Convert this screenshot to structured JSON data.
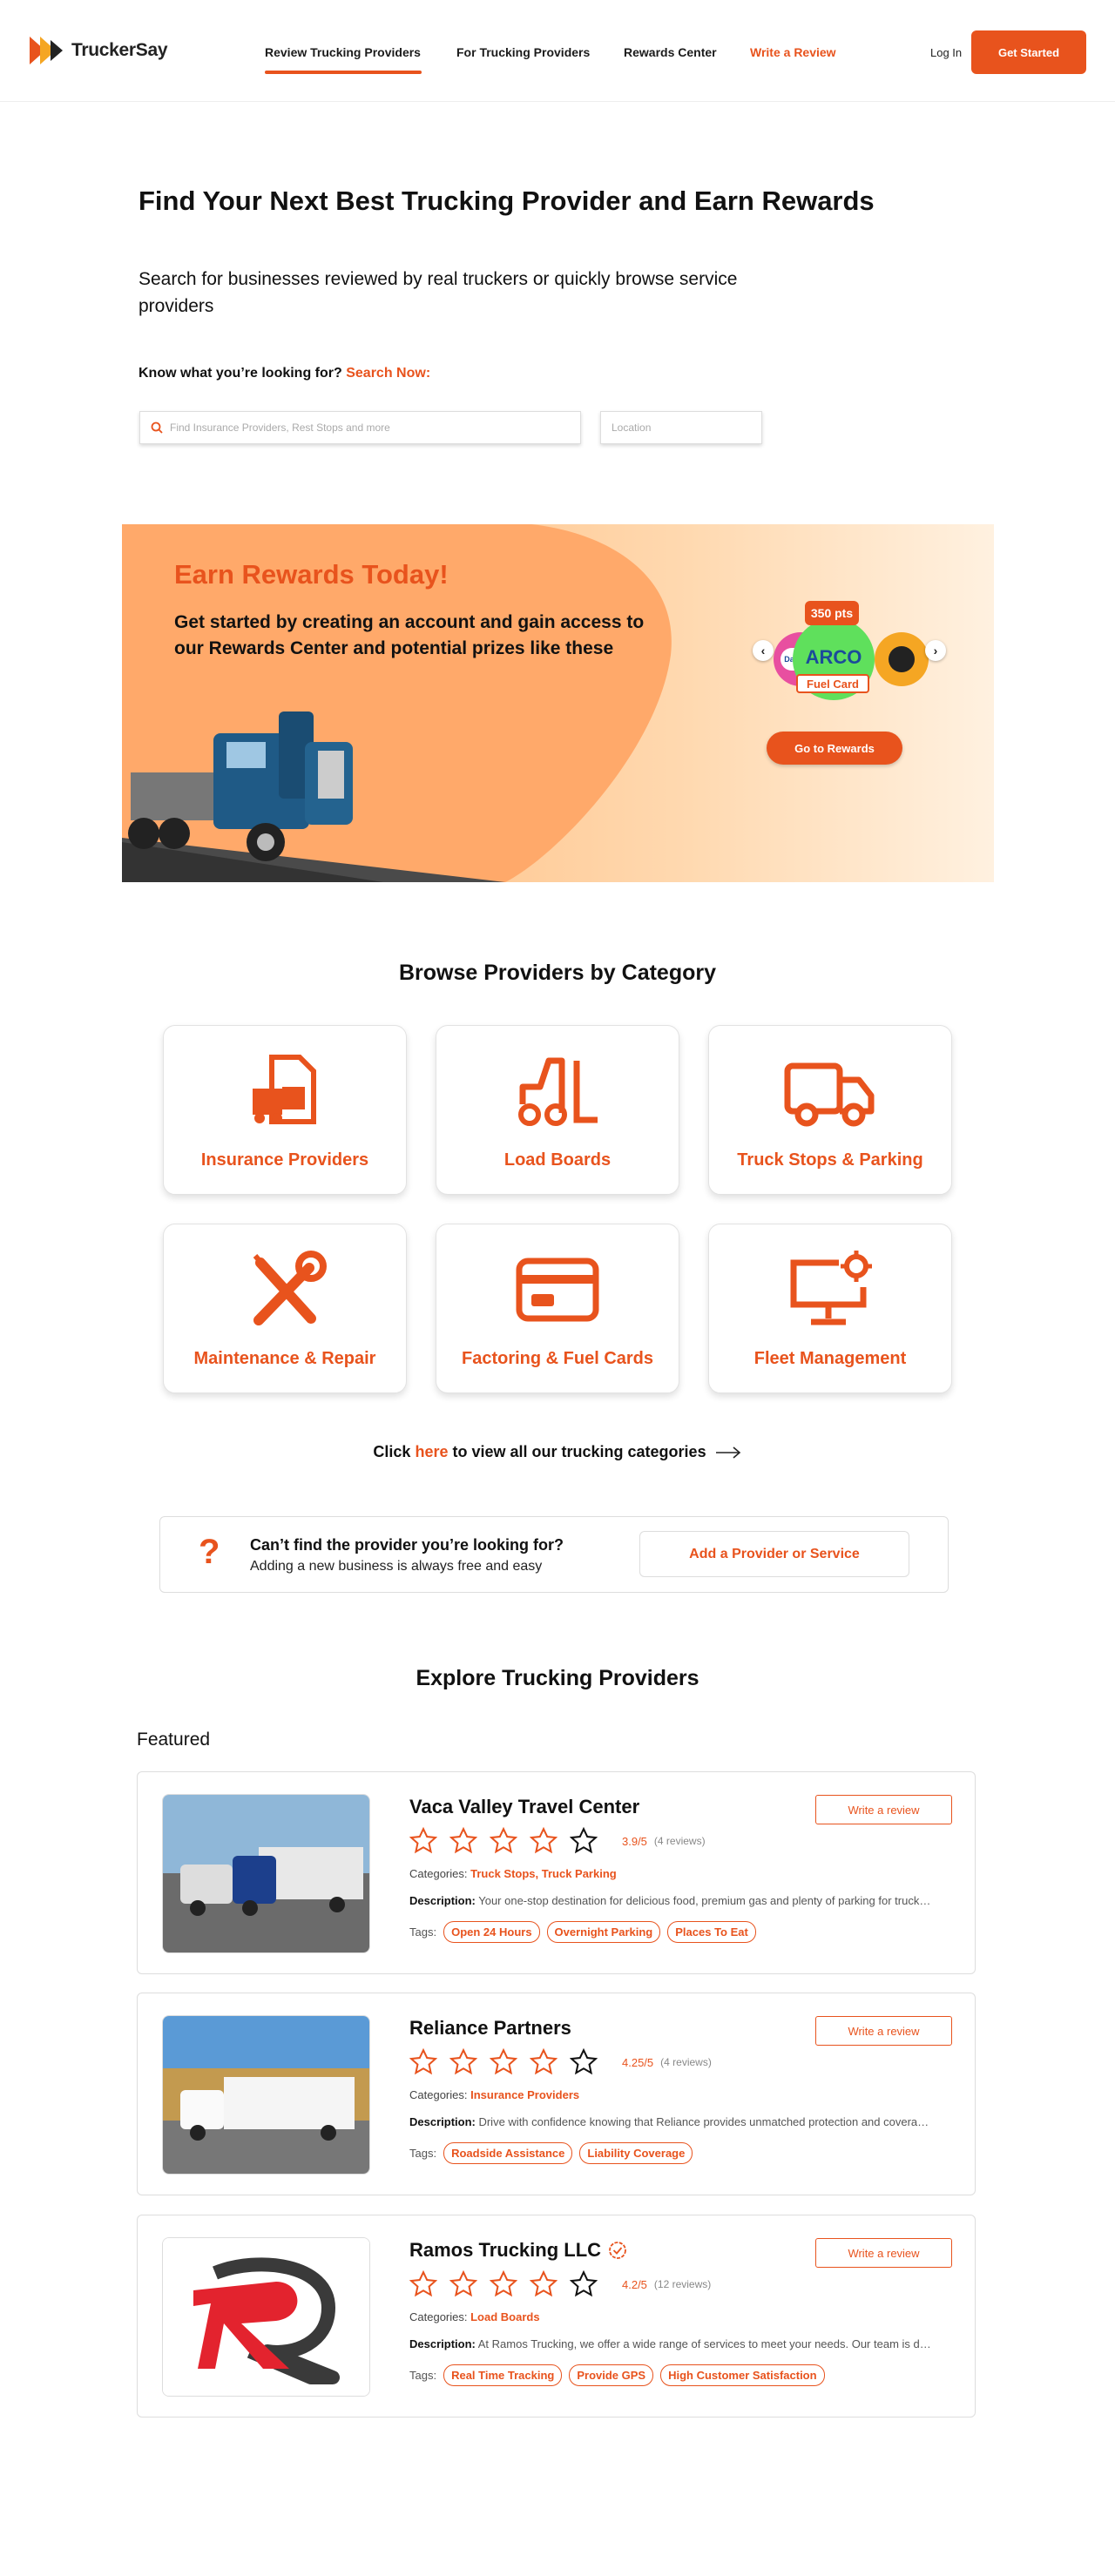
{
  "header": {
    "logo_text": "TruckerSay",
    "nav": [
      "Review Trucking Providers",
      "For Trucking Providers",
      "Rewards Center",
      "Write a Review"
    ],
    "login": "Log In",
    "get_started": "Get Started"
  },
  "hero": {
    "title": "Find Your Next Best Trucking Provider and Earn Rewards",
    "subtitle": "Search for businesses reviewed by real truckers or quickly browse service providers",
    "ask": "Know what you’re looking for?",
    "ask_link": "Search Now:",
    "search_placeholder": "Find Insurance Providers, Rest Stops and more",
    "location_placeholder": "Location"
  },
  "banner": {
    "title": "Earn Rewards Today!",
    "text": "Get started by creating an account and gain access to our Rewards Center and potential prizes like these",
    "points": "350 pts",
    "prize_brand": "ARCO",
    "prize_left": "Days Inn",
    "prize_label": "Fuel Card",
    "button": "Go to Rewards"
  },
  "categories": {
    "title": "Browse Providers by Category",
    "items": [
      "Insurance Providers",
      "Load Boards",
      "Truck Stops & Parking",
      "Maintenance & Repair",
      "Factoring & Fuel Cards",
      "Fleet Management"
    ],
    "click_prefix": "Click",
    "click_link": "here",
    "click_suffix": "to view all our trucking categories"
  },
  "cant_find": {
    "title": "Can’t find the provider you’re looking for?",
    "subtitle": "Adding a new business is always free and easy",
    "button": "Add a Provider or Service"
  },
  "explore": {
    "title": "Explore Trucking Providers",
    "featured": "Featured",
    "categories_label": "Categories:",
    "description_label": "Description:",
    "tags_label": "Tags:",
    "write_review": "Write a review",
    "providers": [
      {
        "name": "Vaca Valley Travel Center",
        "rating": "3.9/5",
        "reviews": "(4 reviews)",
        "categories": "Truck Stops, Truck Parking",
        "description": "Your one-stop destination for delicious food, premium gas and plenty of parking for trucks and cars alike.",
        "tags": [
          "Open 24 Hours",
          "Overnight Parking",
          "Places To Eat"
        ]
      },
      {
        "name": "Reliance Partners",
        "rating": "4.25/5",
        "reviews": "(4 reviews)",
        "categories": "Insurance Providers",
        "description": "Drive with confidence knowing that Reliance provides unmatched protection and coverage for your fleet.",
        "tags": [
          "Roadside Assistance",
          "Liability Coverage"
        ]
      },
      {
        "name": "Ramos Trucking LLC",
        "rating": "4.2/5",
        "reviews": "(12 reviews)",
        "categories": "Load Boards",
        "description": "At Ramos Trucking, we offer a wide range of services to meet your needs. Our team is dedicated to you.",
        "tags": [
          "Real Time Tracking",
          "Provide GPS",
          "High Customer Satisfaction"
        ]
      }
    ]
  },
  "colors": {
    "accent": "#E8531D",
    "banner_light": "#FFD9B0",
    "banner_dark": "#FFB36E"
  }
}
